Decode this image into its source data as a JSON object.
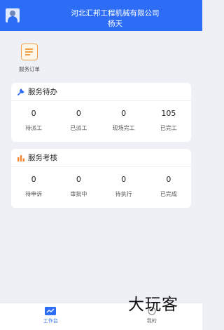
{
  "header": {
    "company": "河北汇邦工程机械有限公司",
    "user": "杨天",
    "avatar_icon": "user-avatar-icon",
    "background": "#2d6df6"
  },
  "shortcuts": [
    {
      "label": "服务订单",
      "icon": "document-list-icon",
      "color": "#f0a044"
    }
  ],
  "pending_card": {
    "title": "服务待办",
    "icon": "wrench-icon",
    "stats": [
      {
        "value": "0",
        "label": "待派工"
      },
      {
        "value": "0",
        "label": "已派工"
      },
      {
        "value": "0",
        "label": "现场完工"
      },
      {
        "value": "105",
        "label": "已完工"
      }
    ]
  },
  "assessment_card": {
    "title": "服务考核",
    "icon": "bar-chart-icon",
    "stats": [
      {
        "value": "0",
        "label": "待申诉"
      },
      {
        "value": "0",
        "label": "审批中"
      },
      {
        "value": "0",
        "label": "待执行"
      },
      {
        "value": "0",
        "label": "已完成"
      }
    ]
  },
  "tabbar": {
    "tabs": [
      {
        "label": "工作台",
        "icon": "workbench-chart-icon",
        "active": true
      },
      {
        "label": "我的",
        "icon": "profile-icon",
        "active": false
      }
    ]
  },
  "watermark": "大玩客"
}
